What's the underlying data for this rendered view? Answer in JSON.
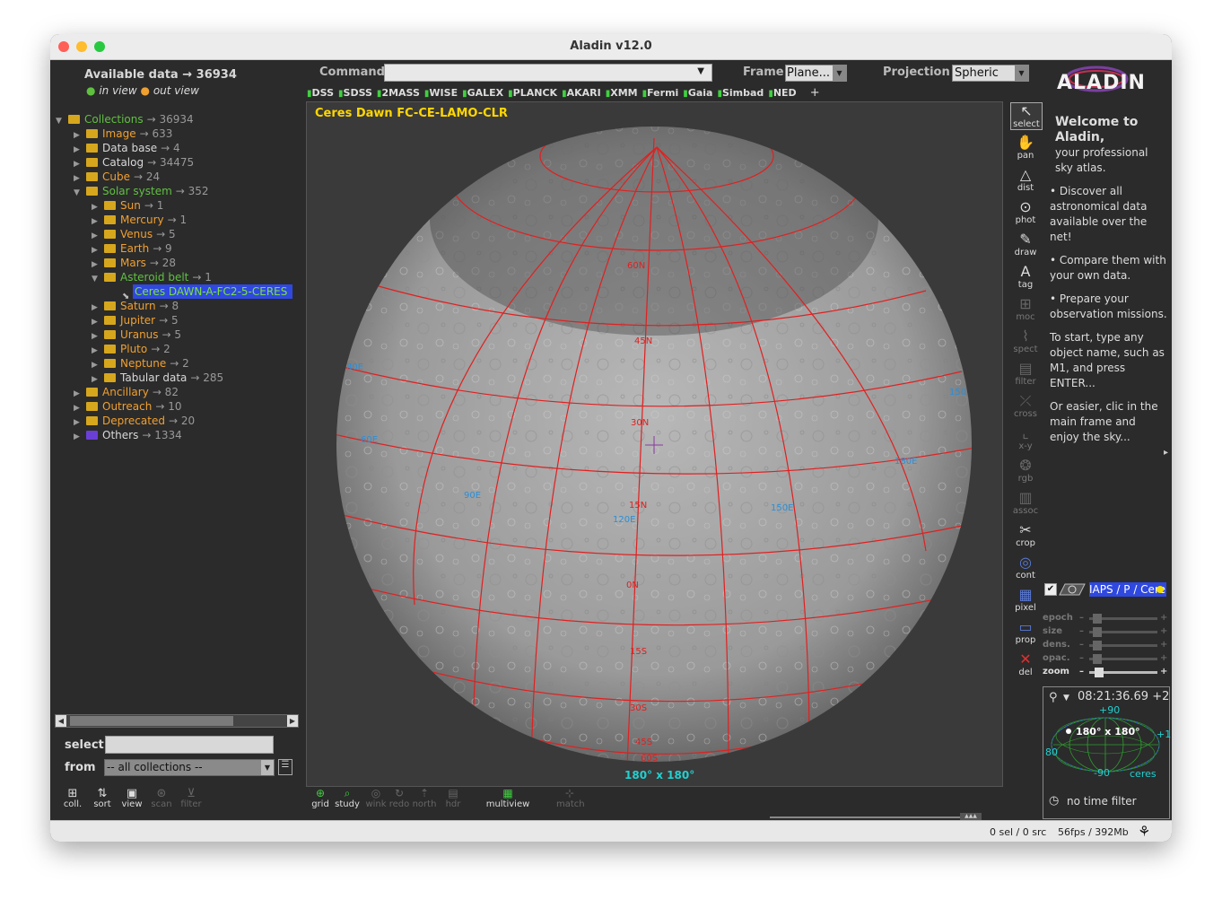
{
  "window": {
    "title": "Aladin v12.0"
  },
  "left": {
    "available_label": "Available data → 36934",
    "in_view": "in view",
    "out_view": "out view",
    "tree": [
      {
        "indent": 0,
        "tri": "▼",
        "label": "Collections",
        "count": "→ 36934",
        "color": "green",
        "folder": "open"
      },
      {
        "indent": 1,
        "tri": "▶",
        "label": "Image",
        "count": "→ 633",
        "color": "orange",
        "folder": "closed"
      },
      {
        "indent": 1,
        "tri": "▶",
        "label": "Data base",
        "count": "→ 4",
        "color": "light",
        "folder": "closed"
      },
      {
        "indent": 1,
        "tri": "▶",
        "label": "Catalog",
        "count": "→ 34475",
        "color": "light",
        "folder": "closed"
      },
      {
        "indent": 1,
        "tri": "▶",
        "label": "Cube",
        "count": "→ 24",
        "color": "orange",
        "folder": "closed"
      },
      {
        "indent": 1,
        "tri": "▼",
        "label": "Solar system",
        "count": "→ 352",
        "color": "green",
        "folder": "open"
      },
      {
        "indent": 2,
        "tri": "▶",
        "label": "Sun",
        "count": "→ 1",
        "color": "orange",
        "folder": "closed"
      },
      {
        "indent": 2,
        "tri": "▶",
        "label": "Mercury",
        "count": "→ 1",
        "color": "orange",
        "folder": "closed"
      },
      {
        "indent": 2,
        "tri": "▶",
        "label": "Venus",
        "count": "→ 5",
        "color": "orange",
        "folder": "closed"
      },
      {
        "indent": 2,
        "tri": "▶",
        "label": "Earth",
        "count": "→ 9",
        "color": "orange",
        "folder": "closed"
      },
      {
        "indent": 2,
        "tri": "▶",
        "label": "Mars",
        "count": "→ 28",
        "color": "orange",
        "folder": "closed"
      },
      {
        "indent": 2,
        "tri": "▼",
        "label": "Asteroid belt",
        "count": "→ 1",
        "color": "green",
        "folder": "open"
      },
      {
        "indent": 3,
        "tri": "",
        "label": "Ceres DAWN-A-FC2-5-CERES",
        "count": "",
        "color": "selected",
        "folder": "leaf"
      },
      {
        "indent": 2,
        "tri": "▶",
        "label": "Saturn",
        "count": "→ 8",
        "color": "orange",
        "folder": "closed"
      },
      {
        "indent": 2,
        "tri": "▶",
        "label": "Jupiter",
        "count": "→ 5",
        "color": "orange",
        "folder": "closed"
      },
      {
        "indent": 2,
        "tri": "▶",
        "label": "Uranus",
        "count": "→ 5",
        "color": "orange",
        "folder": "closed"
      },
      {
        "indent": 2,
        "tri": "▶",
        "label": "Pluto",
        "count": "→ 2",
        "color": "orange",
        "folder": "closed"
      },
      {
        "indent": 2,
        "tri": "▶",
        "label": "Neptune",
        "count": "→ 2",
        "color": "orange",
        "folder": "closed"
      },
      {
        "indent": 2,
        "tri": "▶",
        "label": "Tabular data",
        "count": "→ 285",
        "color": "light",
        "folder": "closed"
      },
      {
        "indent": 1,
        "tri": "▶",
        "label": "Ancillary",
        "count": "→ 82",
        "color": "orange",
        "folder": "closed"
      },
      {
        "indent": 1,
        "tri": "▶",
        "label": "Outreach",
        "count": "→ 10",
        "color": "orange",
        "folder": "closed"
      },
      {
        "indent": 1,
        "tri": "▶",
        "label": "Deprecated",
        "count": "→ 20",
        "color": "orange",
        "folder": "closed"
      },
      {
        "indent": 1,
        "tri": "▶",
        "label": "Others",
        "count": "→ 1334",
        "color": "light",
        "folder": "purple"
      }
    ],
    "select_label": "select",
    "from_label": "from",
    "from_value": "-- all collections --",
    "bottom_buttons": [
      {
        "label": "coll.",
        "enabled": true
      },
      {
        "label": "sort",
        "enabled": true
      },
      {
        "label": "view",
        "enabled": true
      },
      {
        "label": "scan",
        "enabled": false
      },
      {
        "label": "filter",
        "enabled": false
      }
    ]
  },
  "top": {
    "command_label": "Command",
    "frame_label": "Frame",
    "frame_value": "Plane...",
    "projection_label": "Projection",
    "projection_value": "Spheric",
    "surveys": [
      "DSS",
      "SDSS",
      "2MASS",
      "WISE",
      "GALEX",
      "PLANCK",
      "AKARI",
      "XMM",
      "Fermi",
      "Gaia",
      "Simbad",
      "NED"
    ],
    "plus": "+"
  },
  "view": {
    "title": "Ceres Dawn FC-CE-LAMO-CLR",
    "fov": "180° x 180°",
    "grid_labels": [
      {
        "t": "60N",
        "c": "red"
      },
      {
        "t": "45N",
        "c": "red"
      },
      {
        "t": "30N",
        "c": "red"
      },
      {
        "t": "15N",
        "c": "red"
      },
      {
        "t": "0N",
        "c": "red"
      },
      {
        "t": "15S",
        "c": "red"
      },
      {
        "t": "30S",
        "c": "red"
      },
      {
        "t": "45S",
        "c": "red"
      },
      {
        "t": "60S",
        "c": "red"
      },
      {
        "t": "30E",
        "c": "blue"
      },
      {
        "t": "60E",
        "c": "blue"
      },
      {
        "t": "90E",
        "c": "blue"
      },
      {
        "t": "120E",
        "c": "blue"
      },
      {
        "t": "150E",
        "c": "blue"
      },
      {
        "t": "180E",
        "c": "blue"
      },
      {
        "t": "150",
        "c": "blue"
      },
      {
        "t": "E",
        "c": "blue"
      }
    ]
  },
  "bottom_tools": [
    {
      "label": "grid",
      "enabled": true
    },
    {
      "label": "study",
      "enabled": true
    },
    {
      "label": "wink",
      "enabled": false
    },
    {
      "label": "redo",
      "enabled": false
    },
    {
      "label": "north",
      "enabled": false
    },
    {
      "label": "hdr",
      "enabled": false
    },
    {
      "label": "multiview",
      "enabled": true
    },
    {
      "label": "match",
      "enabled": false
    }
  ],
  "vtools": [
    {
      "label": "select",
      "enabled": true,
      "icon": "cursor-icon"
    },
    {
      "label": "pan",
      "enabled": true,
      "icon": "hand-icon"
    },
    {
      "label": "dist",
      "enabled": true,
      "icon": "distance-icon"
    },
    {
      "label": "phot",
      "enabled": true,
      "icon": "photometry-icon"
    },
    {
      "label": "draw",
      "enabled": true,
      "icon": "pencil-icon"
    },
    {
      "label": "tag",
      "enabled": true,
      "icon": "tag-icon"
    },
    {
      "label": "moc",
      "enabled": false,
      "icon": "moc-icon"
    },
    {
      "label": "spect",
      "enabled": false,
      "icon": "spectrum-icon"
    },
    {
      "label": "filter",
      "enabled": false,
      "icon": "filter-icon"
    },
    {
      "label": "cross",
      "enabled": false,
      "icon": "cross-icon"
    },
    {
      "label": "x-y",
      "enabled": false,
      "icon": "xy-icon"
    },
    {
      "label": "rgb",
      "enabled": false,
      "icon": "rgb-icon"
    },
    {
      "label": "assoc",
      "enabled": false,
      "icon": "assoc-icon"
    },
    {
      "label": "crop",
      "enabled": true,
      "icon": "scissors-icon"
    },
    {
      "label": "cont",
      "enabled": true,
      "icon": "contour-icon"
    },
    {
      "label": "pixel",
      "enabled": true,
      "icon": "pixel-icon"
    },
    {
      "label": "prop",
      "enabled": true,
      "icon": "properties-icon"
    },
    {
      "label": "del",
      "enabled": true,
      "icon": "delete-icon"
    }
  ],
  "welcome": {
    "logo": "ALADIN",
    "heading": "Welcome to Aladin,",
    "sub": "your professional sky atlas.",
    "b1": "• Discover all astronomical data available over the net!",
    "b2": "• Compare them with your own data.",
    "b3": "• Prepare your observation missions.",
    "p1": "To start, type any object name, such as M1, and press ENTER...",
    "p2": "Or easier, clic in the main frame and enjoy the sky...",
    "more": "▸"
  },
  "stack": {
    "plane_label": "IAPS / P / Cere",
    "sliders": [
      {
        "label": "epoch",
        "value": 0.05,
        "enabled": false
      },
      {
        "label": "size",
        "value": 0.05,
        "enabled": false
      },
      {
        "label": "dens.",
        "value": 0.05,
        "enabled": false
      },
      {
        "label": "opac.",
        "value": 0.05,
        "enabled": false
      },
      {
        "label": "zoom",
        "value": 0.08,
        "enabled": true
      }
    ]
  },
  "minimap": {
    "coord": "08:21:36.69 +2",
    "fov": "180° x 180°",
    "top": "+90",
    "bottom": "-90",
    "left": "80",
    "right": "+1",
    "name": "ceres",
    "time_filter": "no time filter"
  },
  "status": {
    "sel": "0 sel / 0 src",
    "fps": "56fps / 392Mb"
  },
  "colors": {
    "accent_green": "#60c040",
    "orange": "#f0a030",
    "grid_red": "#e02020",
    "grid_blue": "#2a8fd8",
    "selection": "#2f48e0"
  }
}
